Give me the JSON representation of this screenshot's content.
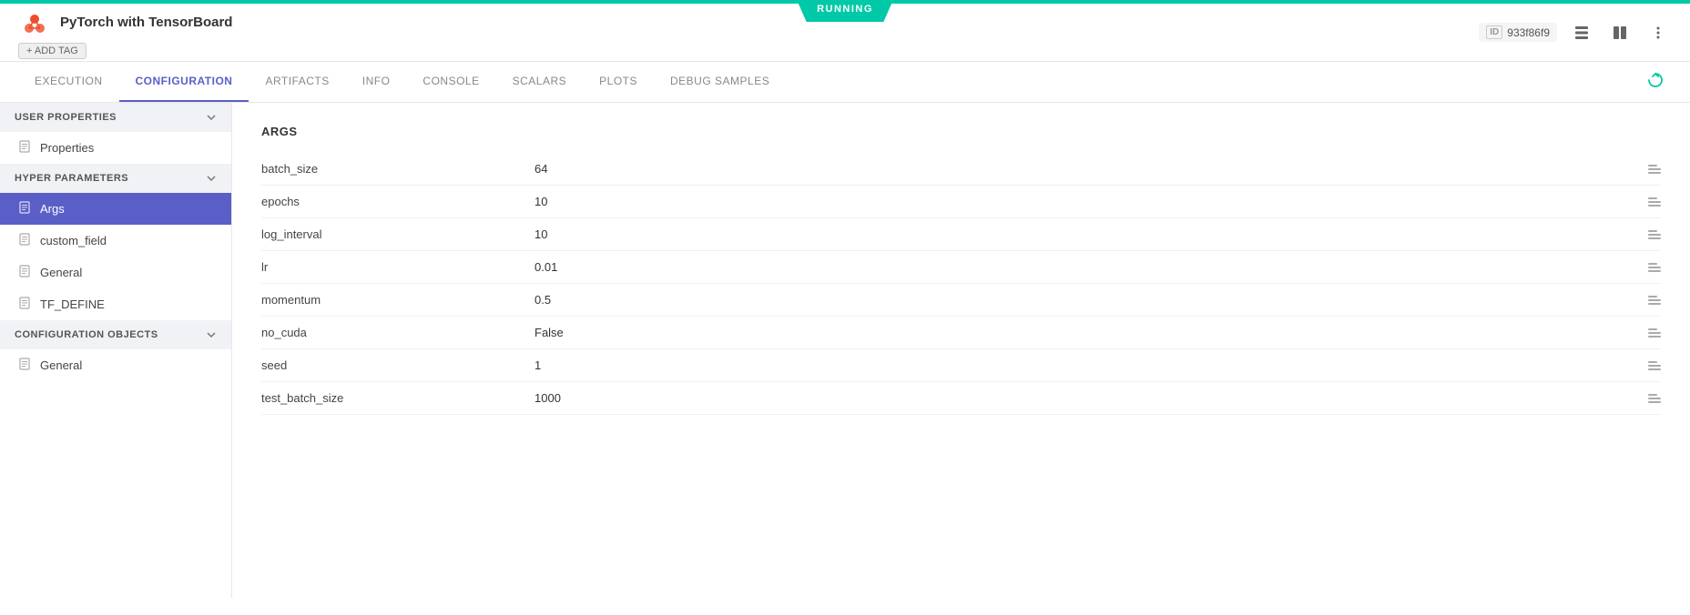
{
  "status": {
    "label": "RUNNING",
    "color": "#00c9a7"
  },
  "header": {
    "title": "PyTorch with TensorBoard",
    "add_tag_label": "+ ADD TAG",
    "id_label": "ID",
    "id_value": "933f86f9"
  },
  "tabs": [
    {
      "id": "execution",
      "label": "EXECUTION",
      "active": false
    },
    {
      "id": "configuration",
      "label": "CONFIGURATION",
      "active": true
    },
    {
      "id": "artifacts",
      "label": "ARTIFACTS",
      "active": false
    },
    {
      "id": "info",
      "label": "INFO",
      "active": false
    },
    {
      "id": "console",
      "label": "CONSOLE",
      "active": false
    },
    {
      "id": "scalars",
      "label": "SCALARS",
      "active": false
    },
    {
      "id": "plots",
      "label": "PLOTS",
      "active": false
    },
    {
      "id": "debug-samples",
      "label": "DEBUG SAMPLES",
      "active": false
    }
  ],
  "sidebar": {
    "sections": [
      {
        "id": "user-properties",
        "label": "USER PROPERTIES",
        "expanded": true,
        "items": [
          {
            "id": "properties",
            "label": "Properties",
            "active": false
          }
        ]
      },
      {
        "id": "hyper-parameters",
        "label": "HYPER PARAMETERS",
        "expanded": true,
        "items": [
          {
            "id": "args",
            "label": "Args",
            "active": true
          },
          {
            "id": "custom_field",
            "label": "custom_field",
            "active": false
          },
          {
            "id": "general",
            "label": "General",
            "active": false
          },
          {
            "id": "tf_define",
            "label": "TF_DEFINE",
            "active": false
          }
        ]
      },
      {
        "id": "configuration-objects",
        "label": "CONFIGURATION OBJECTS",
        "expanded": true,
        "items": [
          {
            "id": "general2",
            "label": "General",
            "active": false
          }
        ]
      }
    ]
  },
  "content": {
    "section_title": "ARGS",
    "params": [
      {
        "name": "batch_size",
        "value": "64"
      },
      {
        "name": "epochs",
        "value": "10"
      },
      {
        "name": "log_interval",
        "value": "10"
      },
      {
        "name": "lr",
        "value": "0.01"
      },
      {
        "name": "momentum",
        "value": "0.5"
      },
      {
        "name": "no_cuda",
        "value": "False"
      },
      {
        "name": "seed",
        "value": "1"
      },
      {
        "name": "test_batch_size",
        "value": "1000"
      }
    ]
  }
}
